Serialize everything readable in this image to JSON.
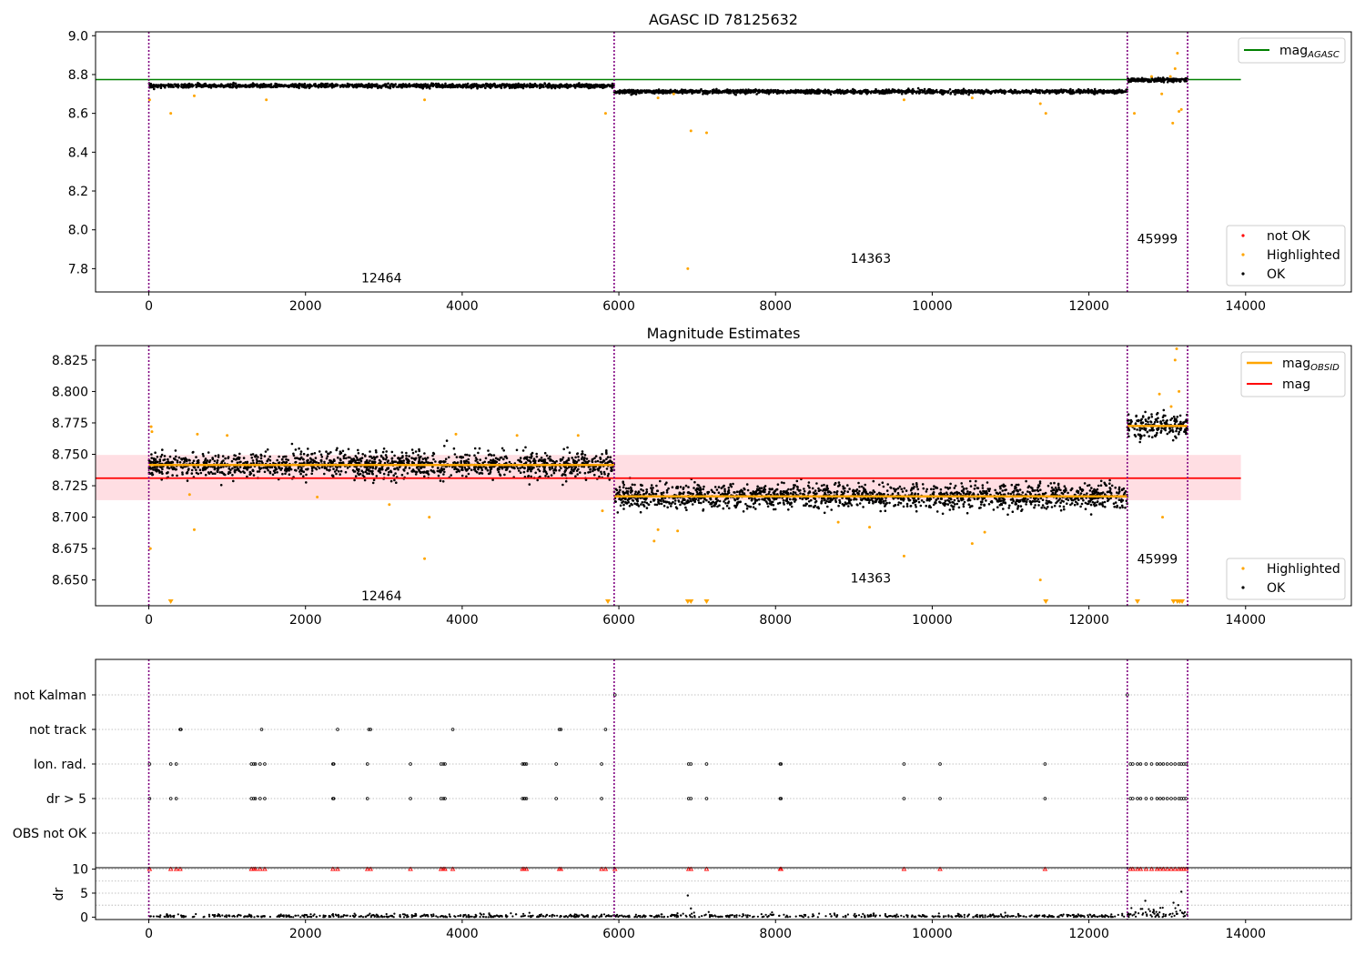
{
  "chart_data": [
    {
      "type": "scatter",
      "title": "AGASC ID 78125632",
      "xlim": [
        -680,
        15350
      ],
      "ylim": [
        7.68,
        9.02
      ],
      "x_ticks": [
        0,
        2000,
        4000,
        6000,
        8000,
        10000,
        12000,
        14000
      ],
      "y_ticks": [
        7.8,
        8.0,
        8.2,
        8.4,
        8.6,
        8.8,
        9.0
      ],
      "y_tick_labels": [
        "7.8",
        "8.0",
        "8.2",
        "8.4",
        "8.6",
        "8.8",
        "9.0"
      ],
      "obs_boundaries": [
        0,
        5940,
        12490,
        13260
      ],
      "obsid_labels": [
        {
          "text": "12464",
          "x": 2970,
          "y": 7.73
        },
        {
          "text": "14363",
          "x": 9215,
          "y": 7.83
        },
        {
          "text": "45999",
          "x": 12875,
          "y": 7.93
        }
      ],
      "lines": [
        {
          "name": "mag",
          "sub": "AGASC",
          "color": "#008000",
          "x": [
            -680,
            13940
          ],
          "y": [
            8.774,
            8.774
          ]
        }
      ],
      "ok_bands": [
        {
          "x": [
            0,
            5940
          ],
          "center": 8.742,
          "spread": 0.008
        },
        {
          "x": [
            5940,
            12490
          ],
          "center": 8.712,
          "spread": 0.008
        },
        {
          "x": [
            12490,
            13260
          ],
          "center": 8.772,
          "spread": 0.008
        }
      ],
      "highlighted_points": [
        [
          10,
          8.67
        ],
        [
          280,
          8.6
        ],
        [
          580,
          8.69
        ],
        [
          1500,
          8.67
        ],
        [
          3520,
          8.67
        ],
        [
          5830,
          8.6
        ],
        [
          6500,
          8.68
        ],
        [
          6700,
          8.7
        ],
        [
          6880,
          7.8
        ],
        [
          6920,
          8.51
        ],
        [
          7120,
          8.5
        ],
        [
          9640,
          8.67
        ],
        [
          10510,
          8.68
        ],
        [
          11380,
          8.65
        ],
        [
          11450,
          8.6
        ],
        [
          12580,
          8.6
        ],
        [
          12930,
          8.7
        ],
        [
          13070,
          8.55
        ],
        [
          13130,
          8.91
        ],
        [
          13150,
          8.61
        ],
        [
          13180,
          8.62
        ],
        [
          13100,
          8.83
        ],
        [
          13040,
          8.79
        ],
        [
          12800,
          8.79
        ]
      ],
      "legend": {
        "entries": [
          "not OK",
          "Highlighted",
          "OK"
        ],
        "position": "lower-right"
      },
      "legend_top": {
        "entries": [
          "mag_AGASC"
        ],
        "position": "upper-right"
      },
      "colors": {
        "ok": "#000000",
        "highlighted": "#ffa500",
        "not_ok": "#ff0000",
        "agasc": "#008000",
        "boundary": "#800080"
      }
    },
    {
      "type": "scatter",
      "title": "Magnitude Estimates",
      "xlim": [
        -680,
        15350
      ],
      "ylim": [
        8.6295,
        8.8365
      ],
      "x_ticks": [
        0,
        2000,
        4000,
        6000,
        8000,
        10000,
        12000,
        14000
      ],
      "y_ticks": [
        8.65,
        8.675,
        8.7,
        8.725,
        8.75,
        8.775,
        8.8,
        8.825
      ],
      "y_tick_labels": [
        "8.650",
        "8.675",
        "8.700",
        "8.725",
        "8.750",
        "8.775",
        "8.800",
        "8.825"
      ],
      "obs_boundaries": [
        0,
        5940,
        12490,
        13260
      ],
      "obsid_labels": [
        {
          "text": "12464",
          "x": 2970,
          "y": 8.634
        },
        {
          "text": "14363",
          "x": 9215,
          "y": 8.648
        },
        {
          "text": "45999",
          "x": 12875,
          "y": 8.663
        }
      ],
      "mag_line": {
        "name": "mag",
        "color": "#ff0000",
        "value": 8.731,
        "x": [
          -680,
          13940
        ]
      },
      "mag_band": {
        "low": 8.7135,
        "high": 8.7495,
        "color": "#ffb6c1"
      },
      "obsid_segments": [
        {
          "x": [
            0,
            5940
          ],
          "value": 8.7415
        },
        {
          "x": [
            5940,
            12490
          ],
          "value": 8.7165
        },
        {
          "x": [
            12490,
            13260
          ],
          "value": 8.7725
        }
      ],
      "ok_bands": [
        {
          "x": [
            0,
            5940
          ],
          "center": 8.7415,
          "spread": 0.0085
        },
        {
          "x": [
            5940,
            12490
          ],
          "center": 8.7165,
          "spread": 0.0082
        },
        {
          "x": [
            12490,
            13260
          ],
          "center": 8.7725,
          "spread": 0.0075
        }
      ],
      "highlighted_points": [
        [
          20,
          8.675
        ],
        [
          30,
          8.772
        ],
        [
          40,
          8.768
        ],
        [
          520,
          8.718
        ],
        [
          580,
          8.69
        ],
        [
          620,
          8.766
        ],
        [
          1000,
          8.765
        ],
        [
          2150,
          8.716
        ],
        [
          3070,
          8.71
        ],
        [
          3520,
          8.667
        ],
        [
          3580,
          8.7
        ],
        [
          3920,
          8.766
        ],
        [
          4700,
          8.765
        ],
        [
          5480,
          8.765
        ],
        [
          5790,
          8.705
        ],
        [
          6450,
          8.681
        ],
        [
          6500,
          8.69
        ],
        [
          6750,
          8.689
        ],
        [
          8800,
          8.696
        ],
        [
          9200,
          8.692
        ],
        [
          9640,
          8.669
        ],
        [
          10510,
          8.679
        ],
        [
          10670,
          8.688
        ],
        [
          11380,
          8.65
        ],
        [
          12940,
          8.7
        ],
        [
          13100,
          8.825
        ],
        [
          13120,
          8.834
        ],
        [
          13150,
          8.8
        ],
        [
          12900,
          8.798
        ],
        [
          13050,
          8.788
        ]
      ],
      "clipped_markers": [
        280,
        5860,
        6880,
        6920,
        7120,
        11450,
        12620,
        13080,
        13130,
        13160,
        13190
      ],
      "legend_top": {
        "entries": [
          "mag_OBSID",
          "mag"
        ],
        "position": "upper-right"
      },
      "legend": {
        "entries": [
          "Highlighted",
          "OK"
        ],
        "position": "lower-right"
      },
      "colors": {
        "ok": "#000000",
        "highlighted": "#ffa500",
        "obsid_line": "#ffa500",
        "mag_line": "#ff0000",
        "boundary": "#800080"
      }
    },
    {
      "type": "scatter",
      "title": "",
      "xlim": [
        -680,
        15350
      ],
      "categories": [
        "not Kalman",
        "not track",
        "Ion. rad.",
        "dr > 5",
        "OBS not OK"
      ],
      "obs_boundaries": [
        0,
        5940,
        12490,
        13260
      ],
      "flag_times": {
        "not Kalman": [
          5950,
          12490
        ],
        "not track": [
          400,
          410,
          1440,
          2410,
          2810,
          2830,
          3880,
          5240,
          5260,
          5830
        ],
        "Ion. rad.": [
          10,
          280,
          350,
          1310,
          1340,
          1360,
          1420,
          1480,
          2350,
          2360,
          2790,
          3340,
          3730,
          3760,
          3780,
          4770,
          4790,
          4800,
          4820,
          5200,
          5780,
          6890,
          6920,
          7120,
          8060,
          8070,
          9640,
          10100,
          11440,
          12530,
          12560,
          12620,
          12660,
          12730,
          12800,
          12870,
          12910,
          12950,
          13000,
          13050,
          13100,
          13150,
          13180,
          13210,
          13240
        ],
        "dr > 5": [
          10,
          280,
          350,
          1310,
          1340,
          1360,
          1420,
          1480,
          2350,
          2360,
          2790,
          3340,
          3730,
          3760,
          3780,
          4770,
          4790,
          4800,
          4820,
          5200,
          5780,
          6890,
          6920,
          7120,
          8060,
          8070,
          9640,
          10100,
          11440,
          12530,
          12560,
          12620,
          12660,
          12730,
          12800,
          12870,
          12910,
          12950,
          13000,
          13050,
          13100,
          13150,
          13180,
          13210,
          13240
        ],
        "OBS not OK": []
      }
    },
    {
      "type": "scatter",
      "ylabel": "dr",
      "xlim": [
        -680,
        15350
      ],
      "ylim": [
        -0.5,
        10.3
      ],
      "x_ticks": [
        0,
        2000,
        4000,
        6000,
        8000,
        10000,
        12000,
        14000
      ],
      "y_ticks": [
        0,
        5,
        10
      ],
      "y_tick_labels": [
        "0",
        "5",
        "10"
      ],
      "obs_boundaries": [
        0,
        5940,
        12490,
        13260
      ],
      "clipped_points": [
        10,
        280,
        350,
        400,
        1310,
        1340,
        1360,
        1420,
        1480,
        2350,
        2410,
        2790,
        2830,
        3340,
        3730,
        3760,
        3780,
        3880,
        4770,
        4790,
        4820,
        5240,
        5260,
        5780,
        5830,
        5950,
        6890,
        6920,
        7120,
        8060,
        8070,
        9640,
        10100,
        11440,
        12530,
        12560,
        12620,
        12660,
        12730,
        12800,
        12870,
        12910,
        12950,
        13000,
        13050,
        13100,
        13150,
        13180,
        13210,
        13240
      ],
      "outliers": [
        [
          6880,
          4.5
        ],
        [
          6920,
          1.8
        ],
        [
          12720,
          3.4
        ],
        [
          13180,
          5.3
        ],
        [
          13080,
          3.0
        ],
        [
          13140,
          2.5
        ]
      ],
      "colors": {
        "ok": "#000000",
        "clipped": "#ff0000",
        "boundary": "#800080"
      }
    }
  ]
}
